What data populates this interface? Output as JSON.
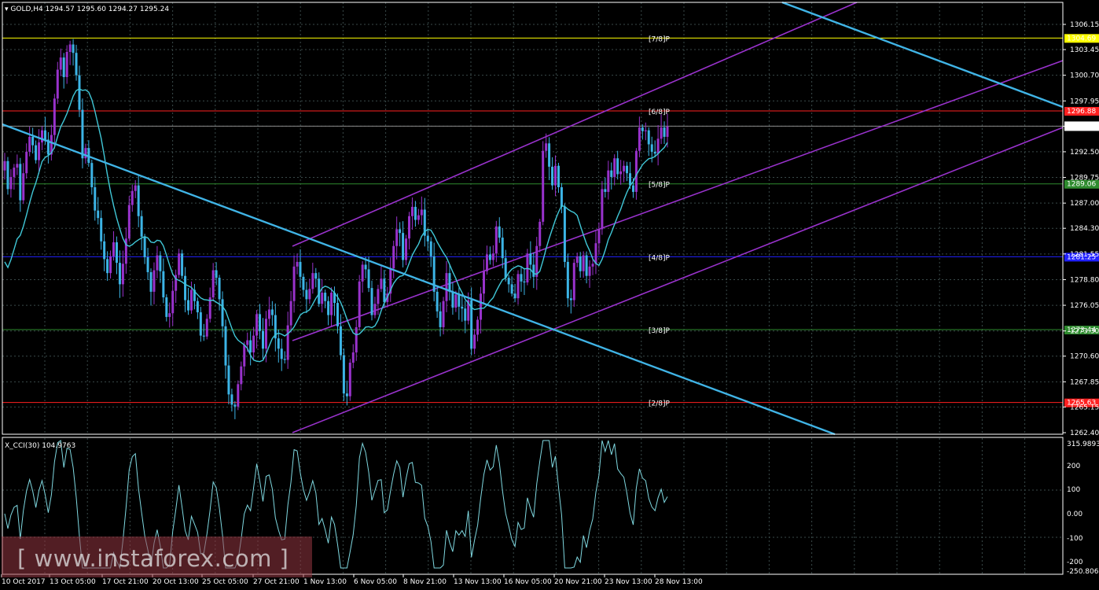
{
  "header": {
    "symbol": "GOLD,H4",
    "ohlc": "1294.57 1295.60 1294.27 1295.24"
  },
  "indicator": {
    "label": "X_CCI(30) 104.9763",
    "scale_labels": [
      "315.9893",
      "200",
      "100",
      "0.00",
      "-100",
      "-200",
      "-250.8065"
    ]
  },
  "watermark": "[ www.instaforex.com ]",
  "colors": {
    "background": "#000000",
    "grid": "#3a4a4a",
    "bull_candle": "#9932cc",
    "bear_candle": "#3cb4e6",
    "ma_line": "#40c8d8",
    "channel": "#9932cc",
    "trend_line": "#40b4e6",
    "cci_line": "#7fd8e0"
  },
  "chart_data": {
    "type": "candlestick",
    "price_axis": [
      "1306.15",
      "1303.45",
      "1300.70",
      "1297.95",
      "1295.24",
      "1292.50",
      "1289.75",
      "1287.00",
      "1284.30",
      "1281.55",
      "1278.80",
      "1276.05",
      "1273.30",
      "1270.60",
      "1267.85",
      "1265.15",
      "1262.40"
    ],
    "ylim": [
      1262.4,
      1306.15
    ],
    "x_axis_labels": [
      "10 Oct 2017",
      "13 Oct 05:00",
      "17 Oct 21:00",
      "20 Oct 13:00",
      "25 Oct 05:00",
      "27 Oct 21:00",
      "1 Nov 13:00",
      "6 Nov 05:00",
      "8 Nov 21:00",
      "13 Nov 13:00",
      "16 Nov 05:00",
      "20 Nov 21:00",
      "23 Nov 13:00",
      "28 Nov 13:00"
    ],
    "last_price": "1295.24",
    "murrey_levels": [
      {
        "name": "[7/8]P",
        "value": "1304.69",
        "color": "#ffff00"
      },
      {
        "name": "[6/8]P",
        "value": "1296.88",
        "color": "#ff2020"
      },
      {
        "name": "[5/8]P",
        "value": "1289.06",
        "color": "#2e8b2e"
      },
      {
        "name": "[4/8]P",
        "value": "1281.25",
        "color": "#2020ff"
      },
      {
        "name": "[3/8]P",
        "value": "1273.44",
        "color": "#2e8b2e"
      },
      {
        "name": "[2/8]P",
        "value": "1265.63",
        "color": "#ff2020"
      }
    ],
    "closes": [
      1291.5,
      1288.5,
      1289.8,
      1290.8,
      1291.2,
      1287.3,
      1290.2,
      1292.5,
      1294.1,
      1293.2,
      1291.6,
      1293.5,
      1294.8,
      1293.8,
      1292.2,
      1294.3,
      1298.2,
      1301.3,
      1302.6,
      1300.5,
      1303.2,
      1304.0,
      1303.1,
      1300.7,
      1297.0,
      1291.8,
      1292.9,
      1291.3,
      1288.7,
      1286.2,
      1285.4,
      1282.9,
      1281.0,
      1279.5,
      1281.3,
      1282.8,
      1280.6,
      1278.3,
      1280.5,
      1283.2,
      1286.8,
      1288.3,
      1288.9,
      1285.6,
      1283.4,
      1281.2,
      1279.6,
      1277.5,
      1279.8,
      1281.4,
      1279.7,
      1276.9,
      1274.8,
      1275.2,
      1277.6,
      1279.3,
      1281.6,
      1279.2,
      1276.6,
      1275.5,
      1277.7,
      1276.5,
      1275.3,
      1272.8,
      1272.7,
      1274.6,
      1276.9,
      1279.8,
      1279.0,
      1276.7,
      1273.8,
      1269.6,
      1266.5,
      1265.4,
      1265.2,
      1267.6,
      1269.5,
      1271.8,
      1272.3,
      1271.0,
      1272.8,
      1275.1,
      1273.3,
      1271.4,
      1274.6,
      1275.6,
      1275.0,
      1272.5,
      1271.4,
      1270.3,
      1270.2,
      1273.9,
      1276.5,
      1280.2,
      1280.7,
      1279.1,
      1277.7,
      1276.7,
      1277.8,
      1279.5,
      1278.9,
      1276.2,
      1277.4,
      1276.5,
      1275.0,
      1277.4,
      1276.3,
      1273.8,
      1270.7,
      1266.6,
      1266.3,
      1269.9,
      1271.0,
      1273.7,
      1278.6,
      1280.4,
      1279.9,
      1277.9,
      1275.0,
      1276.2,
      1277.8,
      1278.9,
      1276.4,
      1277.3,
      1280.0,
      1282.4,
      1284.2,
      1283.8,
      1280.9,
      1283.2,
      1285.6,
      1286.6,
      1285.2,
      1285.7,
      1286.3,
      1283.5,
      1282.9,
      1281.3,
      1277.5,
      1275.4,
      1273.7,
      1276.5,
      1279.5,
      1277.5,
      1275.8,
      1277.2,
      1275.9,
      1275.7,
      1274.4,
      1276.6,
      1271.4,
      1272.9,
      1274.5,
      1277.3,
      1279.7,
      1281.5,
      1280.9,
      1281.6,
      1284.5,
      1283.3,
      1281.1,
      1279.0,
      1278.3,
      1277.3,
      1276.8,
      1279.4,
      1278.6,
      1278.5,
      1281.6,
      1280.4,
      1279.1,
      1282.4,
      1285.0,
      1292.6,
      1293.4,
      1290.9,
      1288.9,
      1291.0,
      1288.7,
      1286.6,
      1280.7,
      1276.8,
      1276.6,
      1280.6,
      1281.3,
      1279.7,
      1281.4,
      1279.2,
      1280.2,
      1280.5,
      1282.7,
      1284.2,
      1288.5,
      1288.2,
      1290.5,
      1289.8,
      1291.8,
      1290.1,
      1290.4,
      1291.0,
      1290.2,
      1288.9,
      1288.2,
      1292.6,
      1295.1,
      1294.7,
      1294.8,
      1293.3,
      1292.5,
      1292.3,
      1293.9,
      1295.1,
      1294.1,
      1295.2
    ]
  }
}
